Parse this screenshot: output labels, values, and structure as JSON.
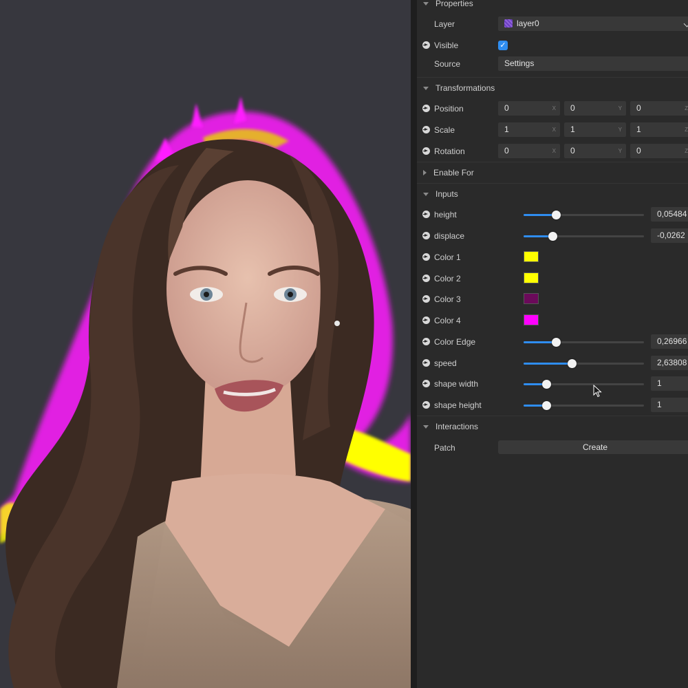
{
  "properties": {
    "title": "Properties",
    "layer": {
      "label": "Layer",
      "value": "layer0"
    },
    "visible": {
      "label": "Visible",
      "checked": true
    },
    "source": {
      "label": "Source",
      "value": "Settings"
    }
  },
  "transformations": {
    "title": "Transformations",
    "rows": [
      {
        "label": "Position",
        "values": [
          "0",
          "0",
          "0"
        ],
        "axes": [
          "X",
          "Y",
          "Z"
        ]
      },
      {
        "label": "Scale",
        "values": [
          "1",
          "1",
          "1"
        ],
        "axes": [
          "X",
          "Y",
          "Z"
        ]
      },
      {
        "label": "Rotation",
        "values": [
          "0",
          "0",
          "0"
        ],
        "axes": [
          "X",
          "Y",
          "Z"
        ]
      }
    ]
  },
  "enable_for": {
    "title": "Enable For"
  },
  "inputs": {
    "title": "Inputs",
    "height": {
      "label": "height",
      "value": "0,05484",
      "slider": 0.27
    },
    "displace": {
      "label": "displace",
      "value": "-0,0262",
      "slider": 0.24
    },
    "color1": {
      "label": "Color 1",
      "color": "#ffff00"
    },
    "color2": {
      "label": "Color 2",
      "color": "#ffff00"
    },
    "color3": {
      "label": "Color 3",
      "color": "#6b0a5a"
    },
    "color4": {
      "label": "Color 4",
      "color": "#ff00ff"
    },
    "color_edge": {
      "label": "Color Edge",
      "value": "0,26966",
      "slider": 0.27
    },
    "speed": {
      "label": "speed",
      "value": "2,63808",
      "slider": 0.4
    },
    "shape_width": {
      "label": "shape width",
      "value": "1",
      "slider": 0.19
    },
    "shape_height": {
      "label": "shape height",
      "value": "1",
      "slider": 0.19
    }
  },
  "interactions": {
    "title": "Interactions",
    "patch": {
      "label": "Patch",
      "button": "Create"
    }
  },
  "colors": {
    "accent": "#2f8df0",
    "panel_bg": "#2a2a2a",
    "viewport_bg": "#37373e"
  }
}
